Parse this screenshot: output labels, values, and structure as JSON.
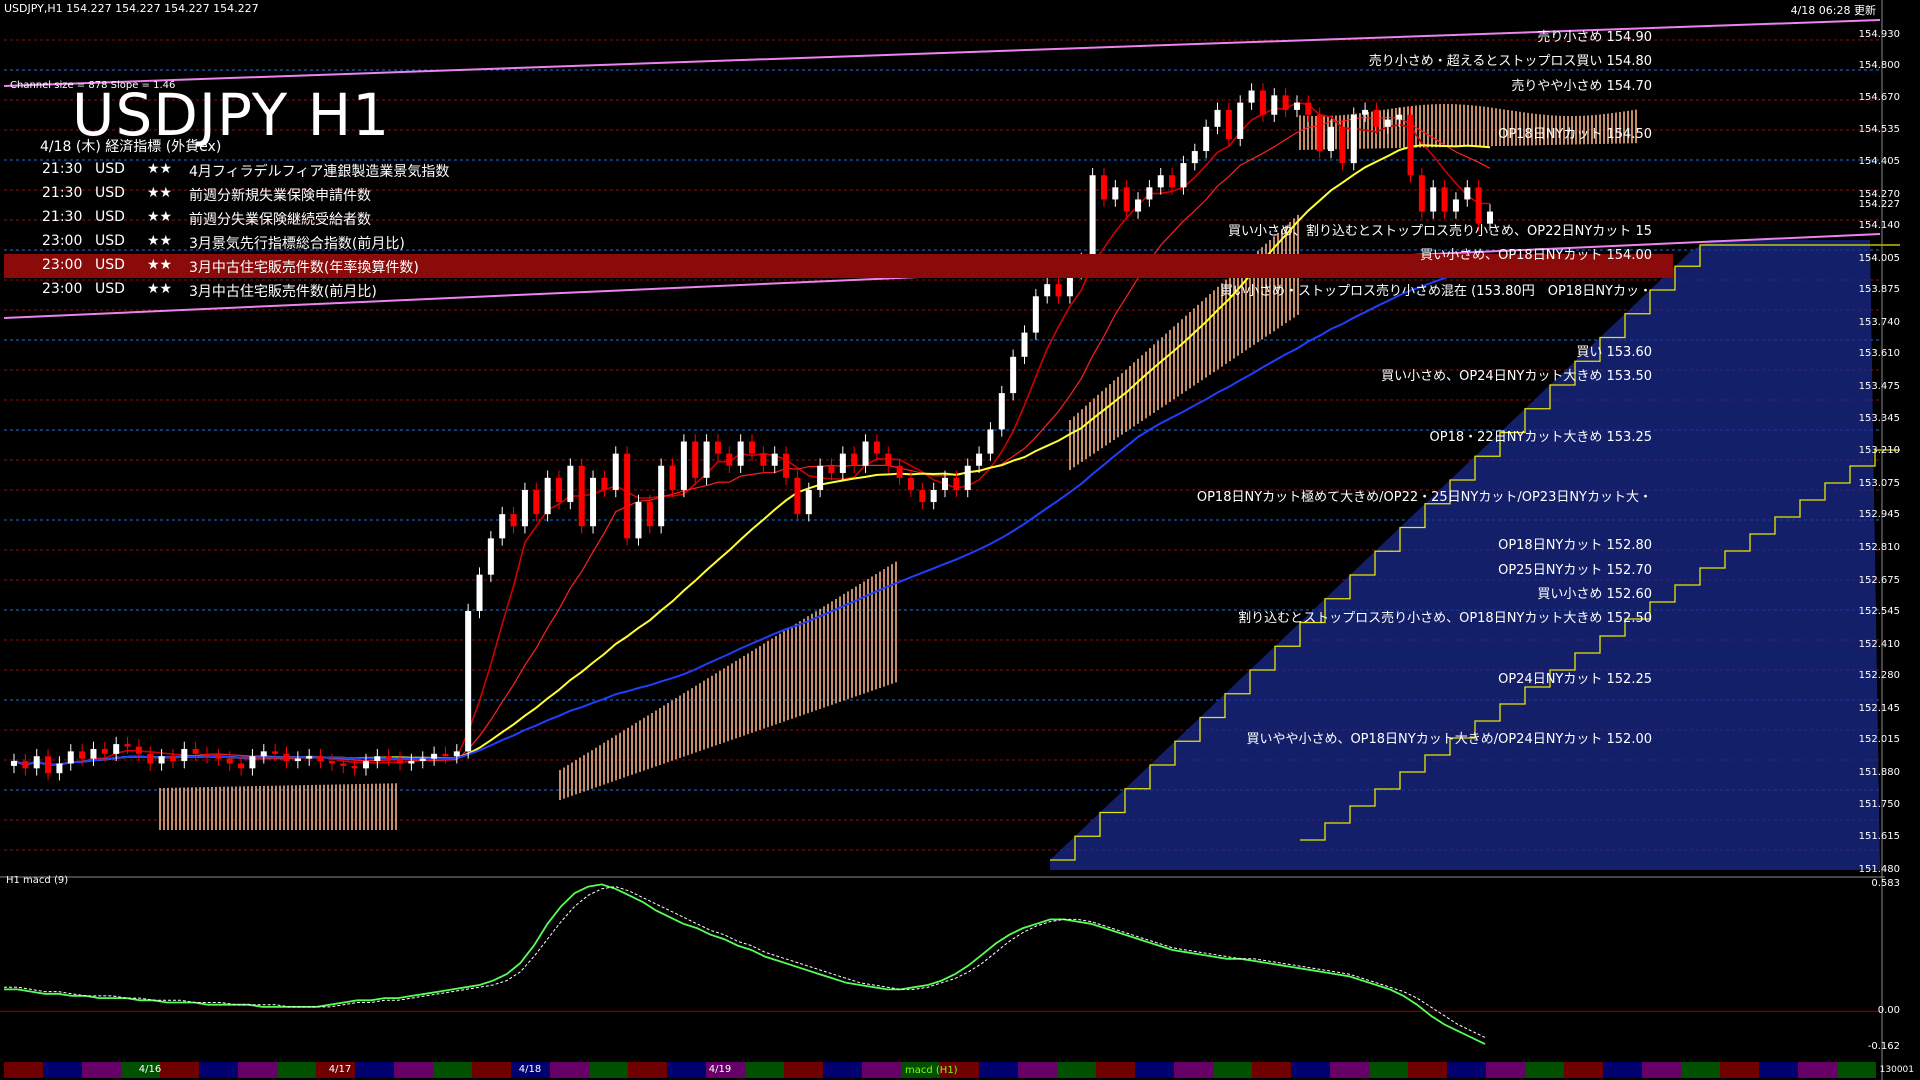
{
  "header": {
    "symbol_bar": "USDJPY,H1  154.227 154.227 154.227 154.227",
    "updated": "4/18 06:28 更新",
    "channel": "Channel size = 878 Slope = 1.46",
    "title": "USDJPY H1",
    "events_heading": "4/18 (木) 経済指標 (外貨ex)"
  },
  "events": [
    {
      "time": "21:30",
      "currency": "USD",
      "stars": "★★",
      "name": "4月フィラデルフィア連銀製造業景気指数",
      "highlight": false
    },
    {
      "time": "21:30",
      "currency": "USD",
      "stars": "★★",
      "name": "前週分新規失業保険申請件数",
      "highlight": false
    },
    {
      "time": "21:30",
      "currency": "USD",
      "stars": "★★",
      "name": "前週分失業保険継続受給者数",
      "highlight": false
    },
    {
      "time": "23:00",
      "currency": "USD",
      "stars": "★★",
      "name": "3月景気先行指標総合指数(前月比)",
      "highlight": false
    },
    {
      "time": "23:00",
      "currency": "USD",
      "stars": "★★",
      "name": "3月中古住宅販売件数(年率換算件数)",
      "highlight": true
    },
    {
      "time": "23:00",
      "currency": "USD",
      "stars": "★★",
      "name": "3月中古住宅販売件数(前月比)",
      "highlight": false
    }
  ],
  "annotations": [
    {
      "text": "売り小さめ 154.90",
      "price": 154.9
    },
    {
      "text": "売り小さめ・超えるとストップロス買い 154.80",
      "price": 154.8
    },
    {
      "text": "売りやや小さめ 154.70",
      "price": 154.7
    },
    {
      "text": "OP18日NYカット 154.50",
      "price": 154.5
    },
    {
      "text": "買い小さめ、割り込むとストップロス売り小さめ、OP22日NYカット 15",
      "price": 154.1
    },
    {
      "text": "買い小さめ、OP18日NYカット 154.00",
      "price": 154.0
    },
    {
      "text": "買い小さめ・ストップロス売り小さめ混在 (153.80円　OP18日NYカッ・",
      "price": 153.85
    },
    {
      "text": "買い 153.60",
      "price": 153.6
    },
    {
      "text": "買い小さめ、OP24日NYカット大きめ 153.50",
      "price": 153.5
    },
    {
      "text": "OP18・22日NYカット大きめ 153.25",
      "price": 153.25
    },
    {
      "text": "OP18日NYカット極めて大きめ/OP22・25日NYカット/OP23日NYカット大・",
      "price": 153.0
    },
    {
      "text": "OP18日NYカット 152.80",
      "price": 152.8
    },
    {
      "text": "OP25日NYカット 152.70",
      "price": 152.7
    },
    {
      "text": "買い小さめ 152.60",
      "price": 152.6
    },
    {
      "text": "割り込むとストップロス売り小さめ、OP18日NYカット大きめ 152.50",
      "price": 152.5
    },
    {
      "text": "OP24日NYカット 152.25",
      "price": 152.25
    },
    {
      "text": "買いやや小さめ、OP18日NYカット大きめ/OP24日NYカット 152.00",
      "price": 152.0
    }
  ],
  "price_axis": [
    "154.930",
    "154.800",
    "154.670",
    "154.535",
    "154.405",
    "154.270",
    "154.227",
    "154.140",
    "154.005",
    "153.875",
    "153.740",
    "153.610",
    "153.475",
    "153.345",
    "153.210",
    "153.075",
    "152.945",
    "152.810",
    "152.675",
    "152.545",
    "152.410",
    "152.280",
    "152.145",
    "152.015",
    "151.880",
    "151.750",
    "151.615",
    "151.480"
  ],
  "macd_axis": [
    "0.583",
    "0.00",
    "-0.162"
  ],
  "macd_label": "H1  macd (9)",
  "dates": [
    "4/16",
    "4/17",
    "4/18",
    "4/19"
  ],
  "tab_label": "macd (H1)",
  "bottom_num": "130001",
  "colors": {
    "bg": "#000000",
    "bull": "#ffffff",
    "bear": "#ff0000",
    "sma_yellow": "#ffff33",
    "sma_blue": "#1f3fff",
    "cloud_orange": "#f4b183",
    "cloud_blue": "#1b2a8c",
    "channel": "#ee82ee",
    "macd": "#55ff55",
    "signal": "#ffffff"
  },
  "chart_data": {
    "type": "candlestick",
    "title": "USDJPY H1",
    "ylim": [
      151.48,
      154.95
    ],
    "closes": [
      151.93,
      151.9,
      151.95,
      151.88,
      151.92,
      151.97,
      151.94,
      151.98,
      151.96,
      152.0,
      151.99,
      151.96,
      151.92,
      151.95,
      151.93,
      151.98,
      151.96,
      151.95,
      151.94,
      151.92,
      151.9,
      151.95,
      151.97,
      151.96,
      151.93,
      151.94,
      151.95,
      151.93,
      151.92,
      151.91,
      151.9,
      151.93,
      151.95,
      151.94,
      151.92,
      151.93,
      151.94,
      151.96,
      151.95,
      151.97,
      152.55,
      152.7,
      152.85,
      152.95,
      152.9,
      153.05,
      152.95,
      153.1,
      153.0,
      153.15,
      152.9,
      153.1,
      153.05,
      153.2,
      152.85,
      153.0,
      152.9,
      153.15,
      153.05,
      153.25,
      153.1,
      153.25,
      153.2,
      153.15,
      153.25,
      153.2,
      153.15,
      153.2,
      153.1,
      152.95,
      153.05,
      153.15,
      153.12,
      153.2,
      153.15,
      153.25,
      153.2,
      153.15,
      153.1,
      153.05,
      153.0,
      153.05,
      153.1,
      153.05,
      153.15,
      153.2,
      153.3,
      153.45,
      153.6,
      153.7,
      153.85,
      153.9,
      153.85,
      153.95,
      154.0,
      154.35,
      154.25,
      154.3,
      154.2,
      154.25,
      154.3,
      154.35,
      154.3,
      154.4,
      154.45,
      154.55,
      154.62,
      154.5,
      154.65,
      154.7,
      154.6,
      154.68,
      154.62,
      154.65,
      154.6,
      154.45,
      154.55,
      154.4,
      154.6,
      154.62,
      154.55,
      154.58,
      154.6,
      154.35,
      154.2,
      154.3,
      154.2,
      154.25,
      154.3,
      154.15,
      154.2
    ],
    "series": [
      {
        "name": "macd",
        "values": [
          0.1,
          0.1,
          0.09,
          0.08,
          0.08,
          0.07,
          0.07,
          0.06,
          0.06,
          0.06,
          0.05,
          0.05,
          0.04,
          0.04,
          0.04,
          0.03,
          0.03,
          0.03,
          0.03,
          0.02,
          0.02,
          0.02,
          0.02,
          0.02,
          0.03,
          0.04,
          0.05,
          0.05,
          0.06,
          0.06,
          0.07,
          0.08,
          0.09,
          0.1,
          0.11,
          0.12,
          0.14,
          0.17,
          0.22,
          0.3,
          0.4,
          0.48,
          0.54,
          0.57,
          0.58,
          0.56,
          0.53,
          0.5,
          0.46,
          0.43,
          0.4,
          0.38,
          0.35,
          0.33,
          0.3,
          0.28,
          0.25,
          0.23,
          0.21,
          0.19,
          0.17,
          0.15,
          0.13,
          0.12,
          0.11,
          0.1,
          0.1,
          0.11,
          0.12,
          0.14,
          0.17,
          0.21,
          0.26,
          0.31,
          0.35,
          0.38,
          0.4,
          0.42,
          0.42,
          0.41,
          0.4,
          0.38,
          0.36,
          0.34,
          0.32,
          0.3,
          0.28,
          0.27,
          0.26,
          0.25,
          0.24,
          0.24,
          0.23,
          0.22,
          0.21,
          0.2,
          0.19,
          0.18,
          0.17,
          0.16,
          0.14,
          0.12,
          0.1,
          0.07,
          0.03,
          -0.02,
          -0.06,
          -0.09,
          -0.12,
          -0.15
        ]
      },
      {
        "name": "signal",
        "values": [
          0.11,
          0.11,
          0.1,
          0.09,
          0.09,
          0.08,
          0.07,
          0.07,
          0.07,
          0.06,
          0.06,
          0.05,
          0.05,
          0.05,
          0.04,
          0.04,
          0.04,
          0.03,
          0.03,
          0.03,
          0.03,
          0.02,
          0.02,
          0.02,
          0.02,
          0.03,
          0.04,
          0.04,
          0.05,
          0.05,
          0.06,
          0.07,
          0.08,
          0.09,
          0.1,
          0.11,
          0.12,
          0.14,
          0.18,
          0.25,
          0.33,
          0.41,
          0.48,
          0.53,
          0.56,
          0.57,
          0.55,
          0.52,
          0.49,
          0.46,
          0.43,
          0.4,
          0.37,
          0.35,
          0.32,
          0.3,
          0.27,
          0.25,
          0.23,
          0.21,
          0.19,
          0.17,
          0.15,
          0.13,
          0.12,
          0.11,
          0.1,
          0.1,
          0.11,
          0.13,
          0.15,
          0.18,
          0.22,
          0.27,
          0.32,
          0.36,
          0.39,
          0.41,
          0.42,
          0.42,
          0.41,
          0.39,
          0.37,
          0.35,
          0.33,
          0.31,
          0.29,
          0.28,
          0.27,
          0.26,
          0.25,
          0.24,
          0.24,
          0.23,
          0.22,
          0.21,
          0.2,
          0.19,
          0.18,
          0.17,
          0.15,
          0.13,
          0.11,
          0.09,
          0.06,
          0.02,
          -0.02,
          -0.06,
          -0.09,
          -0.12
        ]
      }
    ]
  }
}
